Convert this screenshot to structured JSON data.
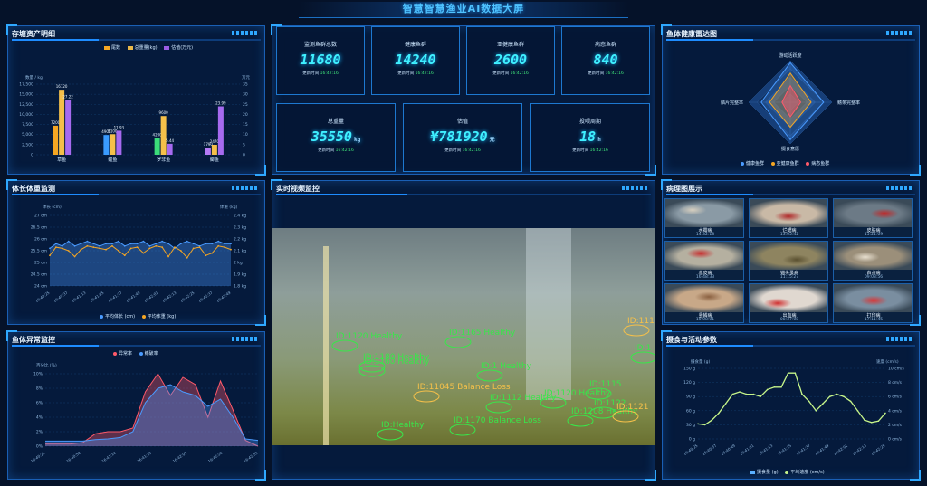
{
  "page": {
    "title": "智慧智慧渔业AI数据大屏"
  },
  "panels": {
    "inventory": "存塘资产明细",
    "growth": "体长体重监测",
    "anomaly": "鱼体异常监控",
    "video": "实时视频监控",
    "radar": "鱼体健康雷达图",
    "pathology": "病理图展示",
    "feeding": "摄食与活动参数"
  },
  "kpis": [
    {
      "label": "监测鱼群总数",
      "value": "11680",
      "unit": "",
      "ts_label": "更新时间",
      "ts": "16:42:16"
    },
    {
      "label": "健康鱼群",
      "value": "14240",
      "unit": "",
      "ts_label": "更新时间",
      "ts": "16:42:16"
    },
    {
      "label": "亚健康鱼群",
      "value": "2600",
      "unit": "",
      "ts_label": "更新时间",
      "ts": "16:42:16"
    },
    {
      "label": "病态鱼群",
      "value": "840",
      "unit": "",
      "ts_label": "更新时间",
      "ts": "16:42:16"
    },
    {
      "label": "总重量",
      "value": "35550",
      "unit": "kg",
      "ts_label": "更新时间",
      "ts": "16:42:16"
    },
    {
      "label": "估值",
      "value": "¥781920",
      "unit": "元",
      "ts_label": "更新时间",
      "ts": "16:42:16"
    },
    {
      "label": "投喂周期",
      "value": "18",
      "unit": "h",
      "ts_label": "更新时间",
      "ts": "16:42:16"
    }
  ],
  "colors": {
    "bar1": "#f5a623",
    "bar2": "#e9b84a",
    "bar3": "#9b5de5",
    "accent": "#2fa8ff",
    "cyan": "#3ff0ff"
  },
  "chart_data": [
    {
      "type": "bar",
      "title": "存塘资产明细",
      "categories": [
        "草鱼",
        "鲤鱼",
        "罗非鱼",
        "鲫鱼"
      ],
      "series": [
        {
          "name": "尾数",
          "values": [
            7200,
            4900,
            4200,
            1790
          ]
        },
        {
          "name": "总重量(kg)",
          "values": [
            16120,
            5100,
            9600,
            2470
          ]
        },
        {
          "name": "估值(万元)",
          "values": [
            27.22,
            11.93,
            5.44,
            23.99
          ]
        }
      ],
      "bar_labels": [
        [
          "7200",
          "16120",
          "27.22"
        ],
        [
          "4900",
          "5100",
          "11.93"
        ],
        [
          "4200",
          "9600",
          "5.44"
        ],
        [
          "1790",
          "2470",
          "23.99"
        ]
      ],
      "yleft_label": "数量 / kg",
      "yright_label": "万元",
      "yleft_ticks": [
        "17,500",
        "15,000",
        "12,500",
        "10,000",
        "7,500",
        "5,000",
        "2,500",
        "0"
      ],
      "yright_ticks": [
        "35",
        "30",
        "25",
        "20",
        "15",
        "10",
        "5",
        "0"
      ]
    },
    {
      "type": "line",
      "title": "体长体重监测",
      "x": [
        "16:40:25",
        "16:40:37",
        "16:41:13",
        "16:41:25",
        "16:41:37",
        "16:41:49",
        "16:42:01",
        "16:42:13",
        "16:42:25",
        "16:42:37",
        "16:42:49"
      ],
      "yleft_label": "体长 (cm)",
      "yright_label": "体重 (kg)",
      "yleft_ticks": [
        "27 cm",
        "26.5 cm",
        "26 cm",
        "25.5 cm",
        "25 cm",
        "24.5 cm",
        "24 cm"
      ],
      "yright_ticks": [
        "2.4 kg",
        "2.3 kg",
        "2.2 kg",
        "2.1 kg",
        "2 kg",
        "1.9 kg",
        "1.8 kg"
      ],
      "series": [
        {
          "name": "平均体长 (cm)",
          "values": [
            25.6,
            25.8,
            25.7,
            25.9,
            25.7,
            25.8,
            25.9,
            25.8,
            25.7,
            25.8,
            25.8,
            25.9,
            25.7,
            25.8,
            25.8,
            25.9,
            25.7,
            25.8,
            25.9,
            25.8,
            25.6,
            25.8,
            25.9,
            25.8,
            25.7,
            25.8,
            25.8,
            25.9,
            25.8,
            25.8
          ]
        },
        {
          "name": "平均体重 (kg)",
          "values": [
            2.06,
            2.13,
            2.12,
            2.1,
            2.05,
            2.11,
            2.14,
            2.13,
            2.12,
            2.11,
            2.14,
            2.1,
            2.06,
            2.12,
            2.13,
            2.08,
            2.12,
            2.14,
            2.13,
            2.05,
            2.13,
            2.1,
            2.04,
            2.12,
            2.13,
            2.06,
            2.08,
            2.14,
            2.13,
            2.11
          ]
        }
      ]
    },
    {
      "type": "area",
      "title": "鱼体异常监控",
      "ylabel": "百分比 (%)",
      "yticks": [
        "10%",
        "8%",
        "6%",
        "4%",
        "2%",
        "0%"
      ],
      "x": [
        "16:40:25",
        "16:40:50",
        "16:41:14",
        "16:41:39",
        "16:42:03",
        "16:42:28",
        "16:42:53"
      ],
      "series": [
        {
          "name": "异常率",
          "values": [
            0.3,
            0.3,
            0.3,
            0.5,
            1.7,
            2.0,
            2.0,
            2.5,
            7.5,
            10.0,
            7.0,
            9.5,
            8.5,
            4.0,
            9.0,
            5.0,
            0.8,
            0
          ]
        },
        {
          "name": "鳍破率",
          "values": [
            0.7,
            0.7,
            0.7,
            0.7,
            0.9,
            1.0,
            1.2,
            2.0,
            6.0,
            8.0,
            8.5,
            7.5,
            7.0,
            5.5,
            6.5,
            4.0,
            1.0,
            0.8
          ]
        }
      ]
    },
    {
      "type": "radar",
      "title": "鱼体健康雷达图",
      "indicators": [
        "游动活跃度",
        "鳍条完整率",
        "摄食意愿",
        "鳞片完整率"
      ],
      "series": [
        {
          "name": "健康鱼群",
          "values": [
            0.95,
            0.8,
            0.9,
            0.7
          ]
        },
        {
          "name": "亚健康鱼群",
          "values": [
            0.7,
            0.5,
            0.6,
            0.5
          ]
        },
        {
          "name": "病态鱼群",
          "values": [
            0.4,
            0.25,
            0.35,
            0.2
          ]
        }
      ]
    },
    {
      "type": "line",
      "title": "摄食与活动参数",
      "yleft_label": "摄食量 (g)",
      "yright_label": "速度 (cm/s)",
      "yleft_ticks": [
        "150 g",
        "120 g",
        "90 g",
        "60 g",
        "30 g",
        "0 g"
      ],
      "yright_ticks": [
        "10 cm/s",
        "8 cm/s",
        "6 cm/s",
        "4 cm/s",
        "2 cm/s",
        "0 cm/s"
      ],
      "x": [
        "16:40:25",
        "16:40:37",
        "16:40:49",
        "16:41:01",
        "16:41:13",
        "16:41:25",
        "16:41:37",
        "16:41:49",
        "16:42:01",
        "16:42:13",
        "16:42:25"
      ],
      "series": [
        {
          "name": "摄食量 (g)",
          "values": [
            32,
            30,
            40,
            55,
            75,
            95,
            100,
            95,
            95,
            90,
            105,
            110,
            110,
            140,
            140,
            95,
            80,
            60,
            75,
            90,
            95,
            90,
            80,
            60,
            40,
            35,
            38,
            55
          ]
        },
        {
          "name": "平均速度 (cm/s)",
          "values": [
            2.1,
            2.0,
            2.7,
            3.7,
            5.0,
            6.3,
            6.7,
            6.3,
            6.3,
            6.0,
            7.0,
            7.3,
            7.3,
            9.3,
            9.3,
            6.3,
            5.3,
            4.0,
            5.0,
            6.0,
            6.3,
            6.0,
            5.3,
            4.0,
            2.7,
            2.3,
            2.5,
            3.7
          ]
        }
      ]
    }
  ],
  "pathology": [
    {
      "name": "水霉病",
      "time": "14:32:18",
      "base": "#8a9aa5",
      "spot": "#d8d0c0"
    },
    {
      "name": "烂鳃病",
      "time": "13:05:42",
      "base": "#c9b9a6",
      "spot": "#b02a2a"
    },
    {
      "name": "皮肤病",
      "time": "15:21:09",
      "base": "#6c7a86",
      "spot": "#c02828"
    },
    {
      "name": "赤皮病",
      "time": "16:48:33",
      "base": "#b5b0a0",
      "spot": "#c73030"
    },
    {
      "name": "锚头蚤病",
      "time": "11:15:27",
      "base": "#8e8460",
      "spot": "#5a5030"
    },
    {
      "name": "白点病",
      "time": "09:03:56",
      "base": "#9b8f7a",
      "spot": "#e8e0d0"
    },
    {
      "name": "竖鳞病",
      "time": "10:08:01",
      "base": "#c8a888",
      "spot": "#8a6040"
    },
    {
      "name": "出血病",
      "time": "08:37:08",
      "base": "#e0d8d0",
      "spot": "#d03030"
    },
    {
      "name": "打印病",
      "time": "17:11:45",
      "base": "#7a8ea0",
      "spot": "#d83838"
    }
  ],
  "video": {
    "labels": [
      "ID:1120 Healthy",
      "ID:1180 Healthy",
      "ID:1165 Healthy",
      "ID:111",
      "ID:1",
      "ID:1160 Healthy",
      "ID:1 Healthy",
      "ID:1115",
      "ID:11045 Balance Loss",
      "ID:1120 Healthy",
      "ID:1112 Healthy",
      "ID:1122",
      "ID:1208 Healthy",
      "ID:1121",
      "ID:1170 Balance Loss",
      "ID:Healthy"
    ]
  }
}
